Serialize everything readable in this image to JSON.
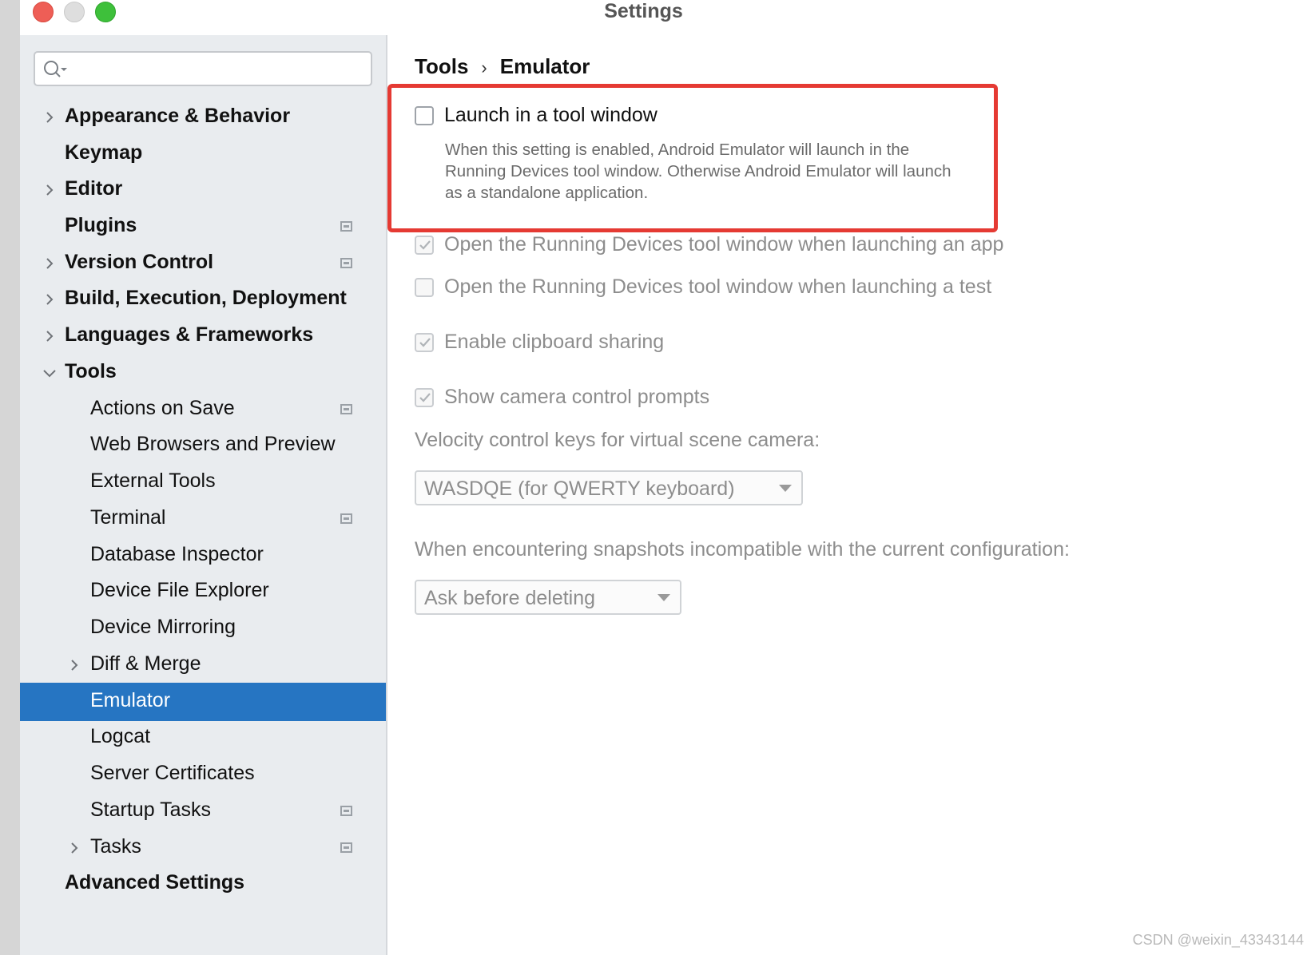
{
  "window": {
    "title": "Settings"
  },
  "search": {
    "placeholder": ""
  },
  "sidebar": {
    "items": [
      {
        "label": "Appearance & Behavior"
      },
      {
        "label": "Keymap"
      },
      {
        "label": "Editor"
      },
      {
        "label": "Plugins"
      },
      {
        "label": "Version Control"
      },
      {
        "label": "Build, Execution, Deployment"
      },
      {
        "label": "Languages & Frameworks"
      },
      {
        "label": "Tools"
      },
      {
        "label": "Actions on Save"
      },
      {
        "label": "Web Browsers and Preview"
      },
      {
        "label": "External Tools"
      },
      {
        "label": "Terminal"
      },
      {
        "label": "Database Inspector"
      },
      {
        "label": "Device File Explorer"
      },
      {
        "label": "Device Mirroring"
      },
      {
        "label": "Diff & Merge"
      },
      {
        "label": "Emulator"
      },
      {
        "label": "Logcat"
      },
      {
        "label": "Server Certificates"
      },
      {
        "label": "Startup Tasks"
      },
      {
        "label": "Tasks"
      },
      {
        "label": "Advanced Settings"
      }
    ]
  },
  "breadcrumb": {
    "parent": "Tools",
    "separator": "›",
    "current": "Emulator"
  },
  "options": {
    "launch_tool_window": {
      "label": "Launch in a tool window",
      "checked": false,
      "description": "When this setting is enabled, Android Emulator will launch in the Running Devices tool window. Otherwise Android Emulator will launch as a standalone application."
    },
    "open_on_app": {
      "label": "Open the Running Devices tool window when launching an app",
      "checked": true
    },
    "open_on_test": {
      "label": "Open the Running Devices tool window when launching a test",
      "checked": false
    },
    "clipboard": {
      "label": "Enable clipboard sharing",
      "checked": true
    },
    "camera_prompts": {
      "label": "Show camera control prompts",
      "checked": true
    }
  },
  "velocity": {
    "label": "Velocity control keys for virtual scene camera:",
    "value": "WASDQE (for QWERTY keyboard)"
  },
  "snapshots": {
    "label": "When encountering snapshots incompatible with the current configuration:",
    "value": "Ask before deleting"
  },
  "watermark": "CSDN @weixin_43343144",
  "colors": {
    "selection": "#2675c2",
    "highlight_box": "#e53a33"
  }
}
